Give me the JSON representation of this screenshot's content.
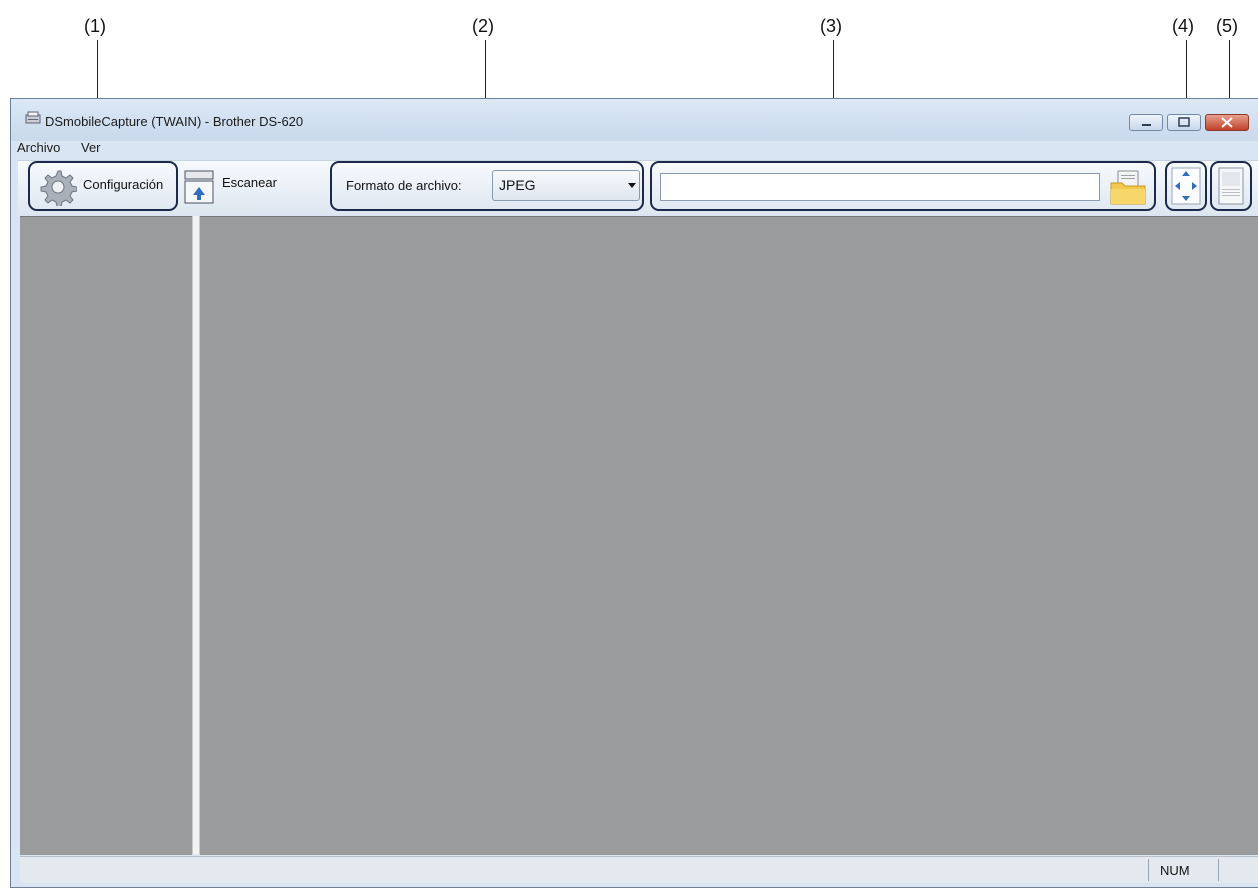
{
  "callouts": [
    "(1)",
    "(2)",
    "(3)",
    "(4)",
    "(5)"
  ],
  "window": {
    "title": "DSmobileCapture (TWAIN) - Brother DS-620"
  },
  "menu": {
    "file": "Archivo",
    "view": "Ver"
  },
  "toolbar": {
    "settings_label": "Configuración",
    "scan_label": "Escanear",
    "format_label": "Formato de archivo:",
    "format_value": "JPEG",
    "path_value": ""
  },
  "status": {
    "num": "NUM"
  },
  "icons": [
    "app-scanner-icon",
    "gear-icon",
    "scanner-icon",
    "folder-icon",
    "fit-arrows-icon",
    "page-icon"
  ]
}
